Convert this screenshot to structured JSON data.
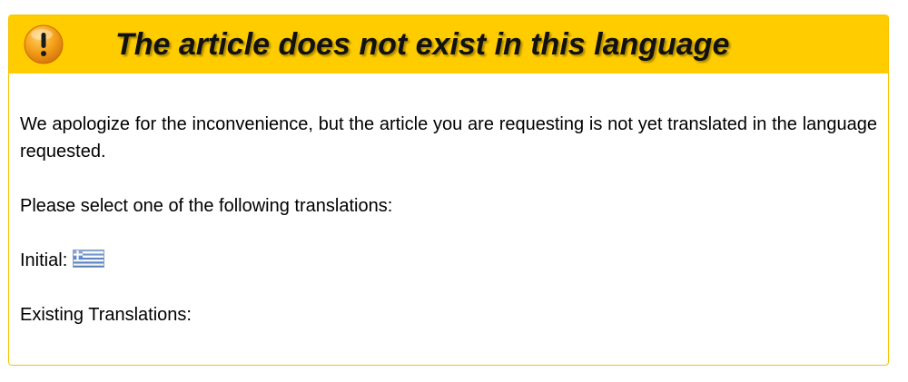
{
  "notice": {
    "title": "The article does not exist in this language",
    "icon": "warning-exclamation-icon",
    "colors": {
      "header_bg": "#ffcc00",
      "border": "#f5c400",
      "icon_orange": "#f39c12"
    }
  },
  "body": {
    "apology": "We apologize for the inconvenience, but the article you are requesting is not yet translated in the language requested.",
    "select_prompt": "Please select one of the following translations:",
    "initial_label": "Initial:",
    "initial_flag_icon": "greek-flag-icon",
    "existing_label": "Existing Translations:"
  }
}
